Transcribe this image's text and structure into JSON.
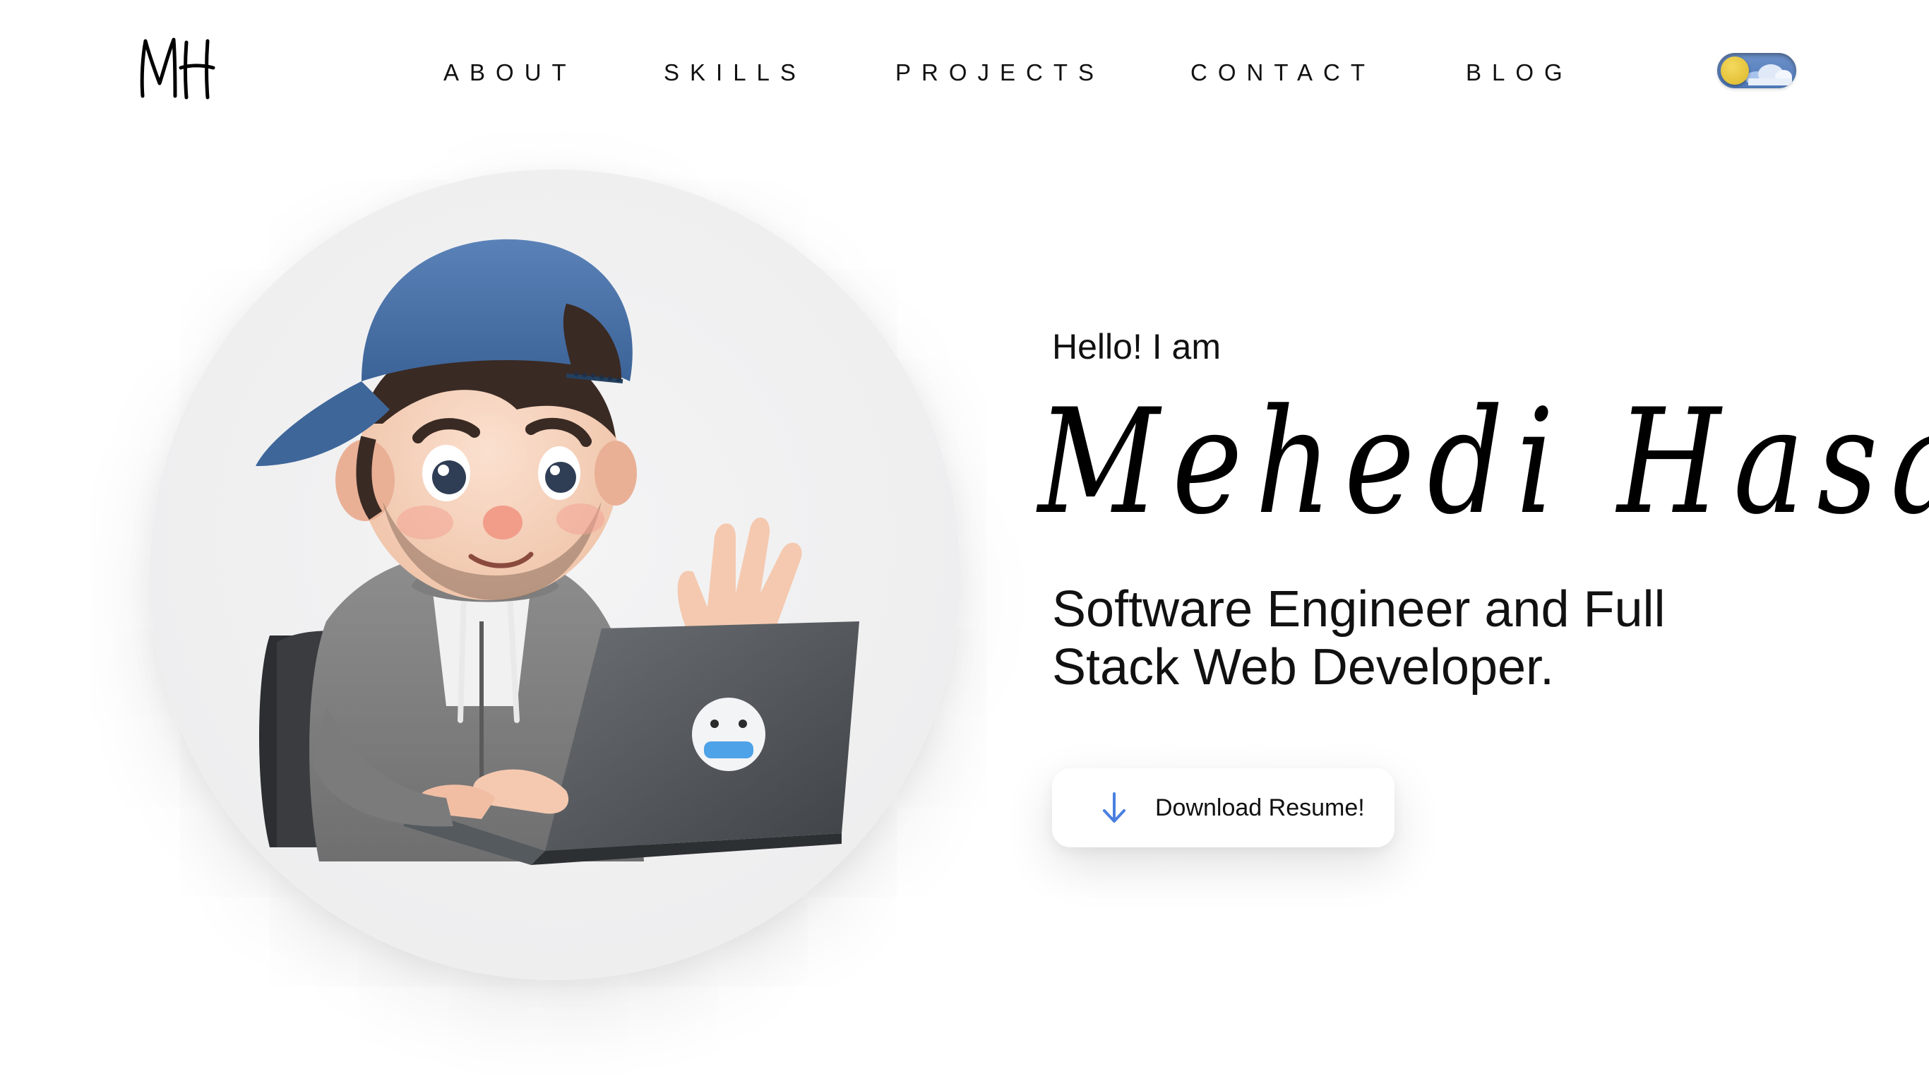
{
  "header": {
    "logo_text": "MH",
    "nav": [
      {
        "label": "ABOUT"
      },
      {
        "label": "SKILLS"
      },
      {
        "label": "PROJECTS"
      },
      {
        "label": "CONTACT"
      },
      {
        "label": "BLOG"
      }
    ],
    "theme_toggle": {
      "state": "light",
      "icon": "sun-cloud-icon"
    }
  },
  "hero": {
    "avatar_icon": "developer-avatar-illustration",
    "greeting": "Hello! I am",
    "name": "Mehedi Hasan",
    "role": "Software Engineer and Full Stack Web Developer.",
    "download_button": {
      "label": "Download Resume!",
      "icon": "arrow-down-icon"
    }
  },
  "colors": {
    "background": "#ffffff",
    "text": "#111111",
    "accent_icon": "#4a7fe0",
    "toggle_track": "#5a82c0",
    "toggle_knob": "#e8c84a"
  }
}
